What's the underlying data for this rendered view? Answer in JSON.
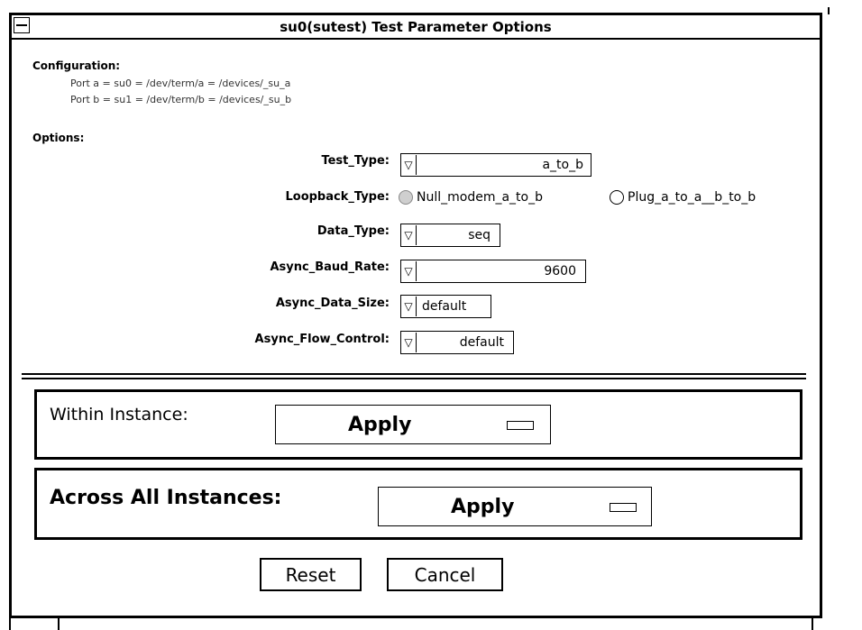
{
  "window": {
    "title": "su0(sutest) Test Parameter Options"
  },
  "configuration": {
    "heading": "Configuration:",
    "lines": [
      "Port a = su0 = /dev/term/a = /devices/_su_a",
      "Port b = su1 = /dev/term/b = /devices/_su_b"
    ]
  },
  "options": {
    "heading": "Options:",
    "test_type": {
      "label": "Test_Type:",
      "value": "a_to_b"
    },
    "loopback_type": {
      "label": "Loopback_Type:",
      "option1": "Null_modem_a_to_b",
      "option2": "Plug_a_to_a__b_to_b",
      "selected": "Null_modem_a_to_b"
    },
    "data_type": {
      "label": "Data_Type:",
      "value": "seq"
    },
    "async_baud_rate": {
      "label": "Async_Baud_Rate:",
      "value": "9600"
    },
    "async_data_size": {
      "label": "Async_Data_Size:",
      "value": "default"
    },
    "async_flow_control": {
      "label": "Async_Flow_Control:",
      "value": "default"
    },
    "dropdown_icon": "down-triangle-icon"
  },
  "within_instance": {
    "label": "Within Instance:",
    "button": "Apply"
  },
  "across_all_instances": {
    "label": "Across All Instances:",
    "button": "Apply"
  },
  "buttons": {
    "reset": "Reset",
    "cancel": "Cancel"
  }
}
